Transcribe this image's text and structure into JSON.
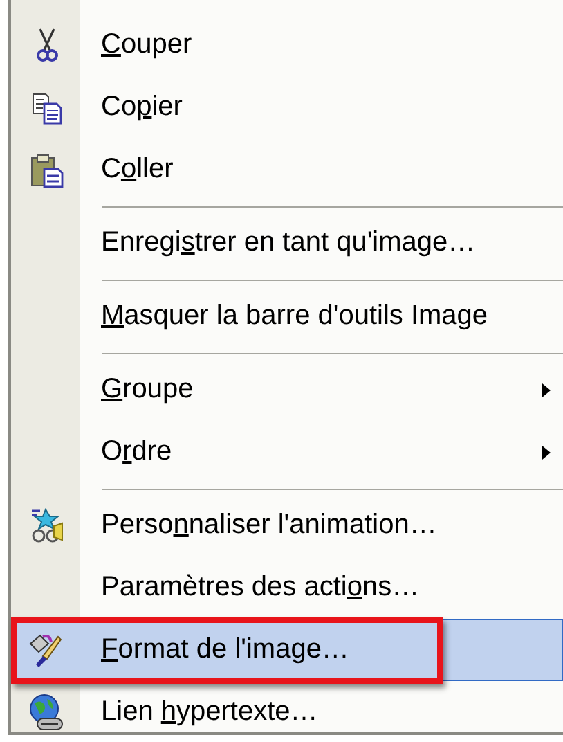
{
  "menu": {
    "items": [
      {
        "kind": "item",
        "icon": true,
        "key": "C",
        "after": "ouper",
        "submenu": false,
        "selected": false,
        "outlined": false
      },
      {
        "kind": "item",
        "icon": true,
        "before": "Co",
        "key": "p",
        "after": "ier",
        "submenu": false,
        "selected": false,
        "outlined": false
      },
      {
        "kind": "item",
        "icon": true,
        "before": "C",
        "key": "o",
        "after": "ller",
        "submenu": false,
        "selected": false,
        "outlined": false
      },
      {
        "kind": "separator"
      },
      {
        "kind": "item",
        "icon": false,
        "before": "Enregi",
        "key": "s",
        "after": "trer en tant qu'image…",
        "submenu": false,
        "selected": false,
        "outlined": false
      },
      {
        "kind": "separator"
      },
      {
        "kind": "item",
        "icon": false,
        "key": "M",
        "after": "asquer la barre d'outils Image",
        "submenu": false,
        "selected": false,
        "outlined": false
      },
      {
        "kind": "separator"
      },
      {
        "kind": "item",
        "icon": false,
        "key": "G",
        "after": "roupe",
        "submenu": true,
        "selected": false,
        "outlined": false
      },
      {
        "kind": "item",
        "icon": false,
        "before": "O",
        "key": "r",
        "after": "dre",
        "submenu": true,
        "selected": false,
        "outlined": false
      },
      {
        "kind": "separator"
      },
      {
        "kind": "item",
        "icon": true,
        "before": "Perso",
        "key": "n",
        "after": "naliser l'animation…",
        "submenu": false,
        "selected": false,
        "outlined": false
      },
      {
        "kind": "item",
        "icon": false,
        "before": "Paramètres des acti",
        "key": "o",
        "after": "ns…",
        "submenu": false,
        "selected": false,
        "outlined": false
      },
      {
        "kind": "item",
        "icon": true,
        "key": "F",
        "after": "ormat de l'image…",
        "submenu": false,
        "selected": true,
        "outlined": true
      },
      {
        "kind": "item",
        "icon": true,
        "before": "Lien ",
        "key": "h",
        "after": "ypertexte…",
        "submenu": false,
        "selected": false,
        "outlined": false
      }
    ]
  }
}
